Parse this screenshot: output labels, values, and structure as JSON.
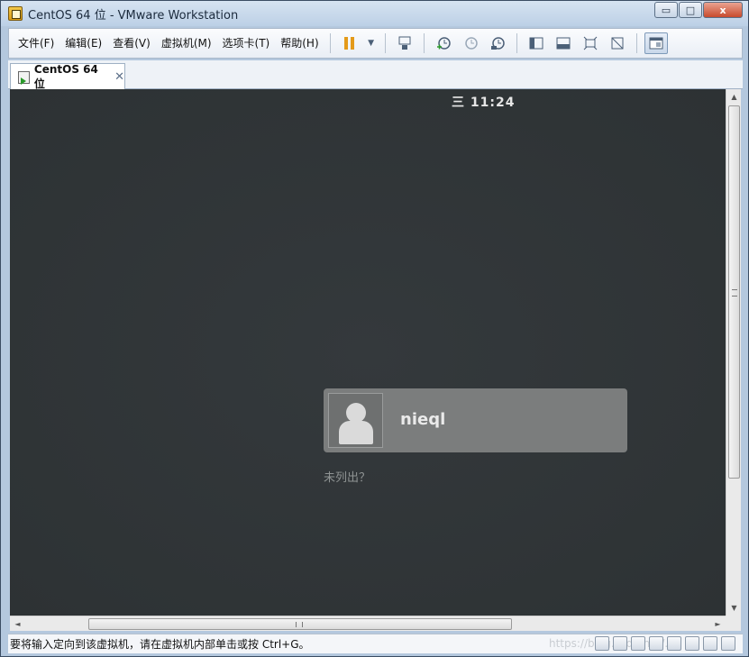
{
  "window": {
    "title": "CentOS 64 位 - VMware Workstation",
    "controls": {
      "minimize": "▭",
      "maximize": "□",
      "close": "x"
    }
  },
  "menu": {
    "items": [
      "文件(F)",
      "编辑(E)",
      "查看(V)",
      "虚拟机(M)",
      "选项卡(T)",
      "帮助(H)"
    ]
  },
  "toolbar": {
    "icons": [
      "pause-icon",
      "dropdown-arrow-icon",
      "send-ctrl-alt-del-icon",
      "snapshot-take-icon",
      "snapshot-revert-icon",
      "snapshot-manager-icon",
      "sidebar-icon",
      "thumbnail-bar-icon",
      "fullscreen-icon",
      "unity-icon",
      "console-view-icon"
    ],
    "dropdown_glyph": "▼"
  },
  "tab": {
    "label": "CentOS 64 位",
    "close": "✕"
  },
  "vm": {
    "clock_menu_glyph": "三",
    "clock": "11:24",
    "user": {
      "name": "nieql"
    },
    "not_listed": "未列出？"
  },
  "scroll": {
    "up": "▲",
    "down": "▼",
    "left": "◄",
    "right": "►"
  },
  "status": {
    "message": "要将输入定向到该虚拟机，请在虚拟机内部单击或按 Ctrl+G。",
    "watermark": "https://blog.csdn.net/..."
  },
  "colors": {
    "vm_background": "#2f3436",
    "user_card": "#7b7d7d",
    "pause_accent": "#e49a1a"
  }
}
